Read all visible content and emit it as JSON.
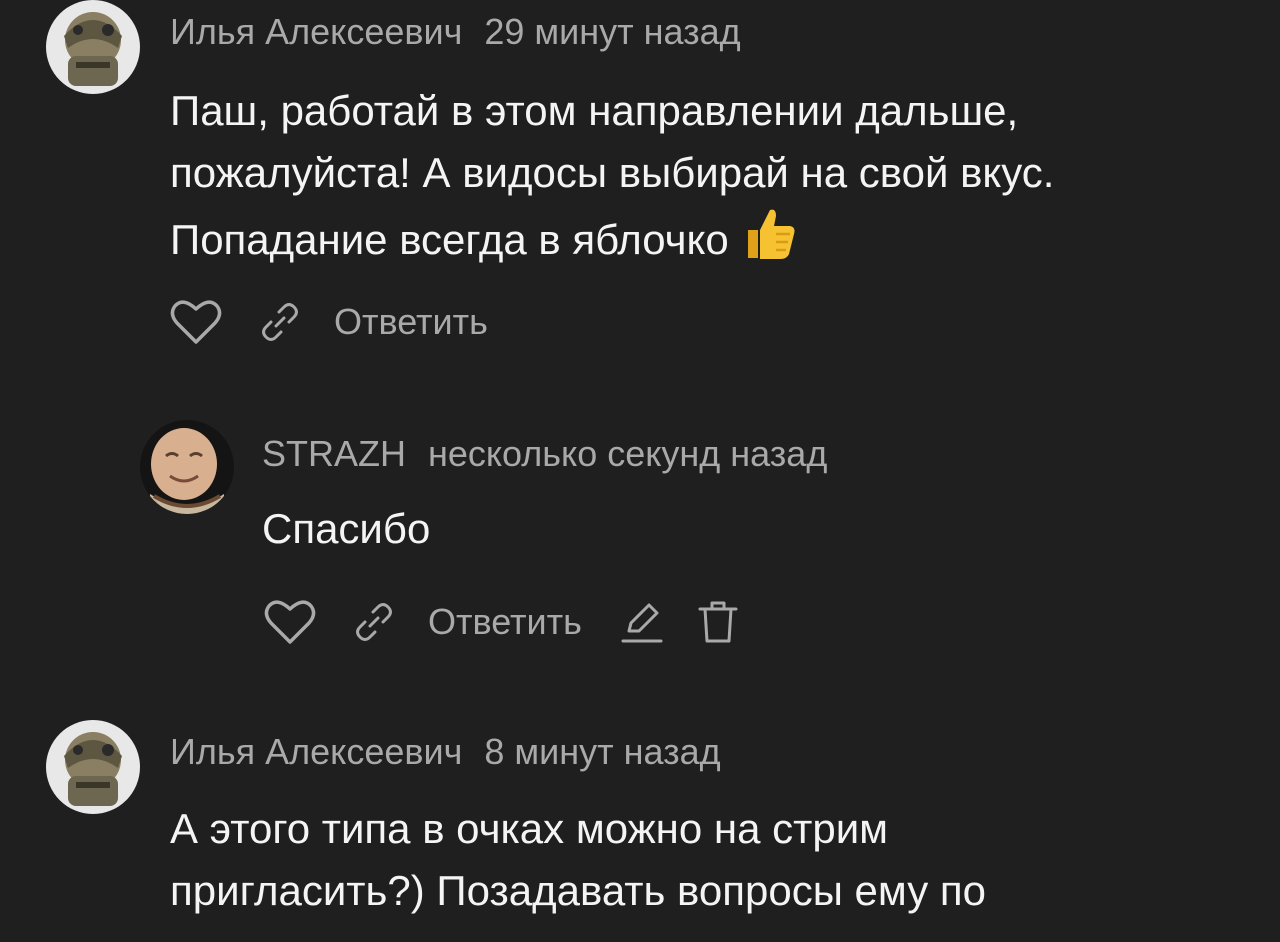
{
  "comments": [
    {
      "author": "Илья Алексеевич",
      "time": "29 минут назад",
      "lines": [
        "Паш, работай в этом направлении дальше,",
        "пожалуйста! А видосы выбирай на свой вкус.",
        "Попадание всегда в яблочко"
      ],
      "emoji": "thumbs-up",
      "reply_label": "Ответить"
    },
    {
      "author": "STRAZH",
      "time": "несколько секунд назад",
      "lines": [
        "Спасибо"
      ],
      "reply_label": "Ответить"
    },
    {
      "author": "Илья Алексеевич",
      "time": "8 минут назад",
      "lines": [
        "А этого типа в очках можно на стрим",
        "пригласить?) Позадавать вопросы ему по"
      ],
      "reply_label": ""
    }
  ],
  "icons": {
    "like": "heart-icon",
    "share": "link-icon",
    "edit": "pencil-icon",
    "delete": "trash-icon"
  },
  "colors": {
    "background": "#1f1f1f",
    "text": "#f4f4f4",
    "muted": "#a9a9a9"
  }
}
